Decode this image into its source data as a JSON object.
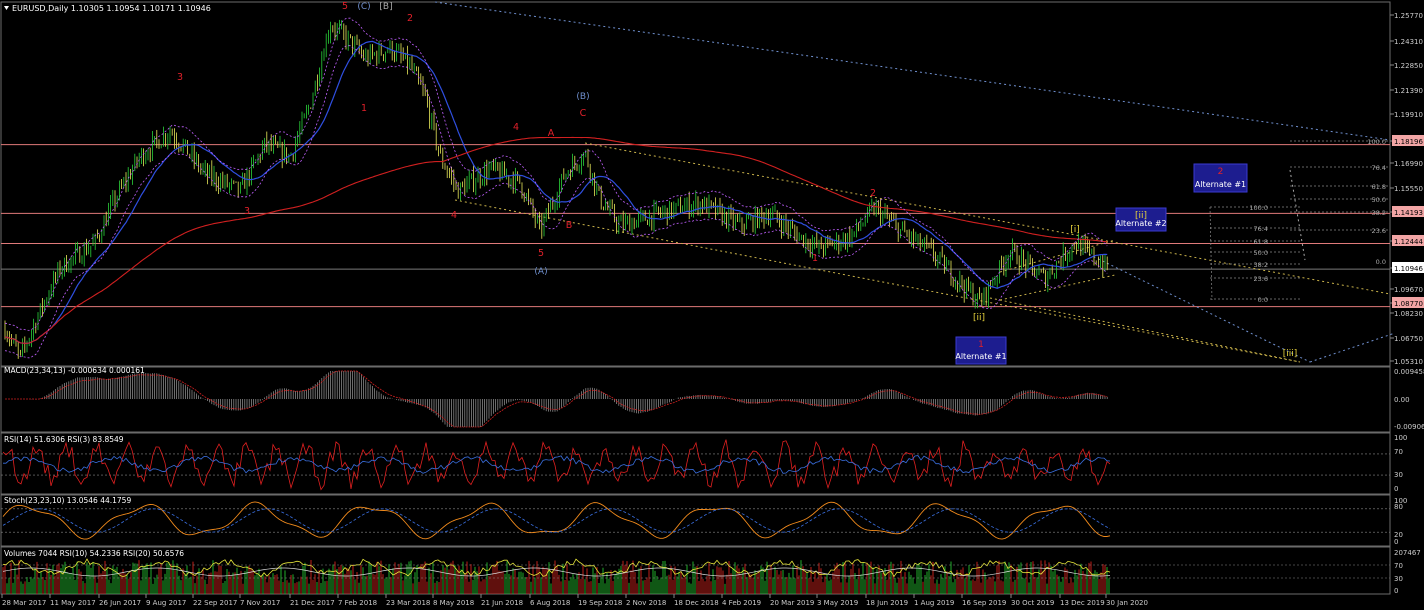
{
  "main": {
    "header": "EURUSD,Daily  1.10305 1.10954 1.10171 1.10946",
    "current_price": "1.10946",
    "price_ticks": [
      "1.25770",
      "1.24310",
      "1.22850",
      "1.21390",
      "1.19910",
      "1.18196",
      "1.16990",
      "1.15550",
      "1.14193",
      "1.12444",
      "1.10946",
      "1.09670",
      "1.08770",
      "1.08230",
      "1.06750",
      "1.05310"
    ],
    "highlight_prices": [
      "1.18196",
      "1.14193",
      "1.12444",
      "1.10946",
      "1.08770"
    ],
    "wave_labels": [
      {
        "text": "5",
        "color": "#e0202a"
      },
      {
        "text": "(C)",
        "color": "#6f8fce"
      },
      {
        "text": "[B]",
        "color": "#aaaaaa"
      },
      {
        "text": "2",
        "color": "#e0202a"
      },
      {
        "text": "3",
        "color": "#e0202a"
      },
      {
        "text": "1",
        "color": "#e0202a"
      },
      {
        "text": "4",
        "color": "#e0202a"
      },
      {
        "text": "3",
        "color": "#e0202a"
      },
      {
        "text": "4",
        "color": "#e0202a"
      },
      {
        "text": "A",
        "color": "#e0202a"
      },
      {
        "text": "(B)",
        "color": "#6f8fce"
      },
      {
        "text": "C",
        "color": "#e0202a"
      },
      {
        "text": "B",
        "color": "#e0202a"
      },
      {
        "text": "5",
        "color": "#e0202a"
      },
      {
        "text": "(A)",
        "color": "#6f8fce"
      },
      {
        "text": "1",
        "color": "#e0202a"
      },
      {
        "text": "2",
        "color": "#e0202a"
      },
      {
        "text": "[i]",
        "color": "#e6d23c"
      },
      {
        "text": "[ii]",
        "color": "#e6d23c"
      },
      {
        "text": "[iii]",
        "color": "#e6d23c"
      }
    ],
    "boxes": [
      {
        "num": "2",
        "label": "Alternate #1"
      },
      {
        "num": "[ii]",
        "label": "Alternate #2"
      },
      {
        "num": "1",
        "label": "Alternate #1"
      }
    ],
    "fib_right": [
      "100.0",
      "76.4",
      "61.8",
      "50.0",
      "38.2",
      "23.6"
    ],
    "fib_left": [
      "100.0",
      "76.4",
      "61.8",
      "50.0",
      "38.2",
      "23.6",
      "0.0"
    ],
    "fib_zero": "0.0"
  },
  "macd": {
    "header": "MACD(23,34,13) -0.000634 0.000161",
    "ticks": [
      "0.009458",
      "0.00",
      "-0.009065"
    ]
  },
  "rsi": {
    "header": "RSI(14) 51.6306  RSI(3) 83.8549",
    "ticks": [
      "100",
      "70",
      "30",
      "0"
    ]
  },
  "stoch": {
    "header": "Stoch(23,23,10) 13.0546 44.1759",
    "ticks": [
      "100",
      "80",
      "20",
      "0"
    ]
  },
  "volumes": {
    "header": "Volumes 7044  RSI(10) 54.2336  RSI(20) 50.6576",
    "ticks": [
      "207467",
      "70",
      "30",
      "0"
    ]
  },
  "x_axis": [
    "28 Mar 2017",
    "11 May 2017",
    "26 Jun 2017",
    "9 Aug 2017",
    "22 Sep 2017",
    "7 Nov 2017",
    "21 Dec 2017",
    "7 Feb 2018",
    "23 Mar 2018",
    "8 May 2018",
    "21 Jun 2018",
    "6 Aug 2018",
    "19 Sep 2018",
    "2 Nov 2018",
    "18 Dec 2018",
    "4 Feb 2019",
    "20 Mar 2019",
    "3 May 2019",
    "18 Jun 2019",
    "1 Aug 2019",
    "16 Sep 2019",
    "30 Oct 2019",
    "13 Dec 2019",
    "30 Jan 2020"
  ],
  "chart_data": {
    "type": "line",
    "title": "EURUSD,Daily",
    "ohlc_last": {
      "open": 1.10305,
      "high": 1.10954,
      "low": 1.10171,
      "close": 1.10946
    },
    "x": [
      "28 Mar 2017",
      "11 May 2017",
      "26 Jun 2017",
      "9 Aug 2017",
      "22 Sep 2017",
      "7 Nov 2017",
      "21 Dec 2017",
      "7 Feb 2018",
      "23 Mar 2018",
      "8 May 2018",
      "21 Jun 2018",
      "6 Aug 2018",
      "19 Sep 2018",
      "2 Nov 2018",
      "18 Dec 2018",
      "4 Feb 2019",
      "20 Mar 2019",
      "3 May 2019",
      "18 Jun 2019",
      "1 Aug 2019",
      "16 Sep 2019",
      "30 Oct 2019",
      "13 Dec 2019",
      "30 Jan 2020"
    ],
    "series": [
      {
        "name": "EURUSD",
        "values": [
          1.07,
          1.09,
          1.135,
          1.185,
          1.18,
          1.165,
          1.19,
          1.245,
          1.232,
          1.185,
          1.165,
          1.14,
          1.17,
          1.14,
          1.14,
          1.135,
          1.125,
          1.12,
          1.13,
          1.115,
          1.095,
          1.11,
          1.11,
          1.109
        ]
      }
    ],
    "ylim": [
      1.0531,
      1.265
    ],
    "grid": false,
    "indicators": {
      "macd": {
        "range": [
          -0.009065,
          0.009458
        ]
      },
      "rsi": {
        "levels": [
          70,
          30
        ]
      },
      "stoch": {
        "levels": [
          80,
          20
        ]
      }
    }
  }
}
